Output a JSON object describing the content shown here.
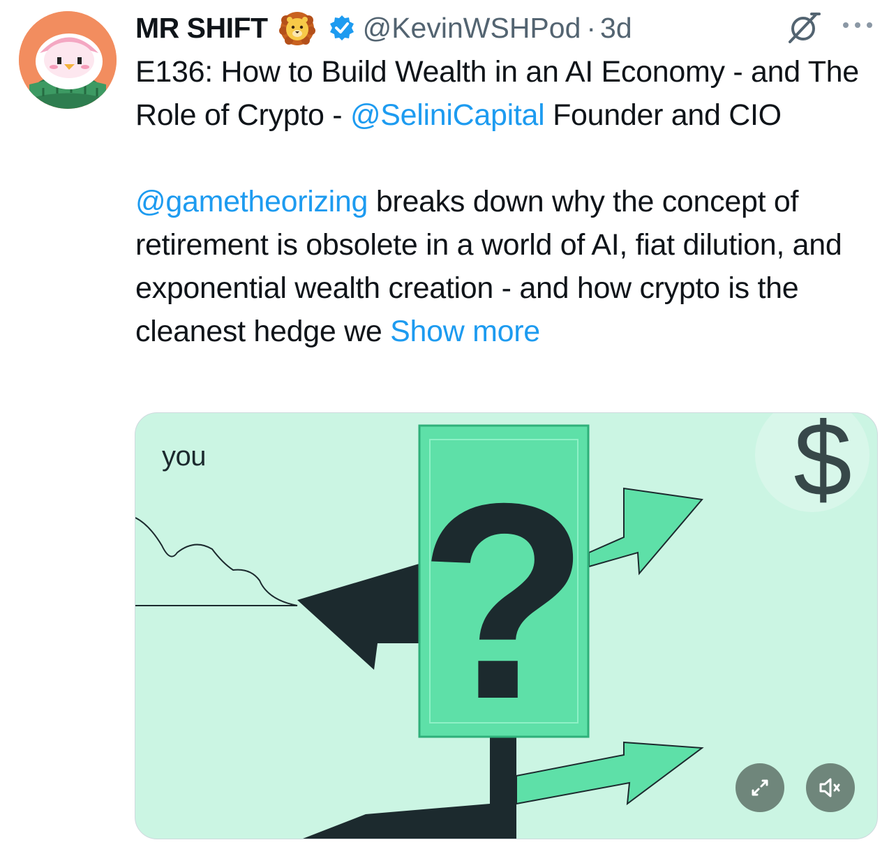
{
  "tweet": {
    "author_name": "MR SHIFT",
    "author_emoji": "lion-face",
    "verified_icon": "verified-badge-icon",
    "handle": "@KevinWSHPod",
    "separator": "·",
    "time_ago": "3d",
    "paragraph1": {
      "text_before": "E136: How to Build Wealth in an AI Economy - and The Role of Crypto - ",
      "mention": "@SeliniCapital",
      "text_after": " Founder and CIO"
    },
    "paragraph2": {
      "mention": "@gametheorizing",
      "text": " breaks down why the concept of retirement is obsolete in a world of AI, fiat dilution, and exponential wealth creation - and how crypto is the cleanest hedge we ",
      "show_more": "Show more"
    }
  },
  "media": {
    "word": "you",
    "sign_symbol": "?",
    "coin_symbol": "$",
    "controls": [
      "expand-icon",
      "muted-speaker-icon"
    ]
  },
  "colors": {
    "link": "#1d9bf0",
    "secondary_text": "#536471",
    "media_background": "#cbf5e3",
    "sign_green": "#5ee0a8",
    "dark_ink": "#1c2a2e",
    "avatar_bg": "#f28d5f"
  }
}
